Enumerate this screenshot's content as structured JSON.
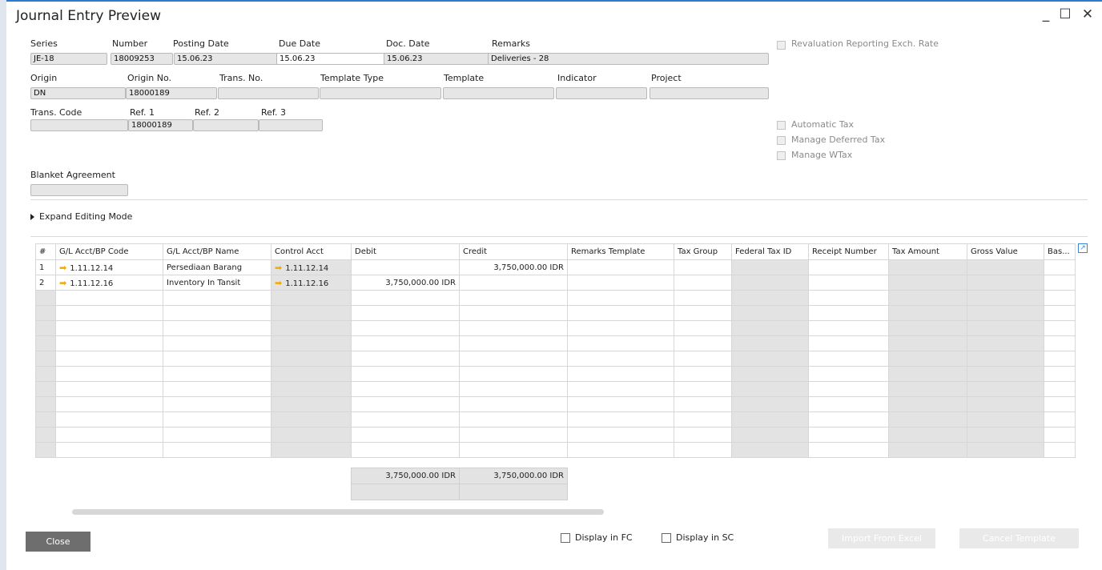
{
  "window": {
    "title": "Journal Entry Preview",
    "controls": {
      "minimize": "_",
      "maximize": "☐",
      "close": "✕"
    }
  },
  "header": {
    "series": {
      "label": "Series",
      "value": "JE-18"
    },
    "number": {
      "label": "Number",
      "value": "18009253"
    },
    "posting_date": {
      "label": "Posting Date",
      "value": "15.06.23"
    },
    "due_date": {
      "label": "Due Date",
      "value": "15.06.23"
    },
    "doc_date": {
      "label": "Doc. Date",
      "value": "15.06.23"
    },
    "remarks": {
      "label": "Remarks",
      "value": "Deliveries - 28"
    },
    "origin": {
      "label": "Origin",
      "value": "DN"
    },
    "origin_no": {
      "label": "Origin No.",
      "value": "18000189"
    },
    "trans_no": {
      "label": "Trans. No.",
      "value": ""
    },
    "template_type": {
      "label": "Template Type",
      "value": ""
    },
    "template": {
      "label": "Template",
      "value": ""
    },
    "indicator": {
      "label": "Indicator",
      "value": ""
    },
    "project": {
      "label": "Project",
      "value": ""
    },
    "trans_code": {
      "label": "Trans. Code",
      "value": ""
    },
    "ref1": {
      "label": "Ref. 1",
      "value": "18000189"
    },
    "ref2": {
      "label": "Ref. 2",
      "value": ""
    },
    "ref3": {
      "label": "Ref. 3",
      "value": ""
    },
    "blanket_agreement": {
      "label": "Blanket Agreement",
      "value": ""
    }
  },
  "options": {
    "revaluation": "Revaluation Reporting Exch. Rate",
    "automatic_tax": "Automatic Tax",
    "manage_deferred_tax": "Manage Deferred Tax",
    "manage_wtax": "Manage WTax"
  },
  "expand_editing": "Expand Editing Mode",
  "grid": {
    "columns": [
      "#",
      "G/L Acct/BP Code",
      "G/L Acct/BP Name",
      "Control Acct",
      "Debit",
      "Credit",
      "Remarks Template",
      "Tax Group",
      "Federal Tax ID",
      "Receipt Number",
      "Tax Amount",
      "Gross Value",
      "Bas..."
    ],
    "rows": [
      {
        "num": "1",
        "code": "1.11.12.14",
        "name": "Persediaan Barang",
        "control": "1.11.12.14",
        "debit": "",
        "credit": "3,750,000.00 IDR"
      },
      {
        "num": "2",
        "code": "1.11.12.16",
        "name": "Inventory In Tansit",
        "control": "1.11.12.16",
        "debit": "3,750,000.00 IDR",
        "credit": ""
      }
    ],
    "arrow_icon": "➡",
    "totals": {
      "debit": "3,750,000.00 IDR",
      "credit": "3,750,000.00 IDR"
    }
  },
  "footer": {
    "close": "Close",
    "display_fc": "Display in FC",
    "display_sc": "Display in SC",
    "import_excel": "Import From Excel",
    "cancel_template": "Cancel Template"
  }
}
